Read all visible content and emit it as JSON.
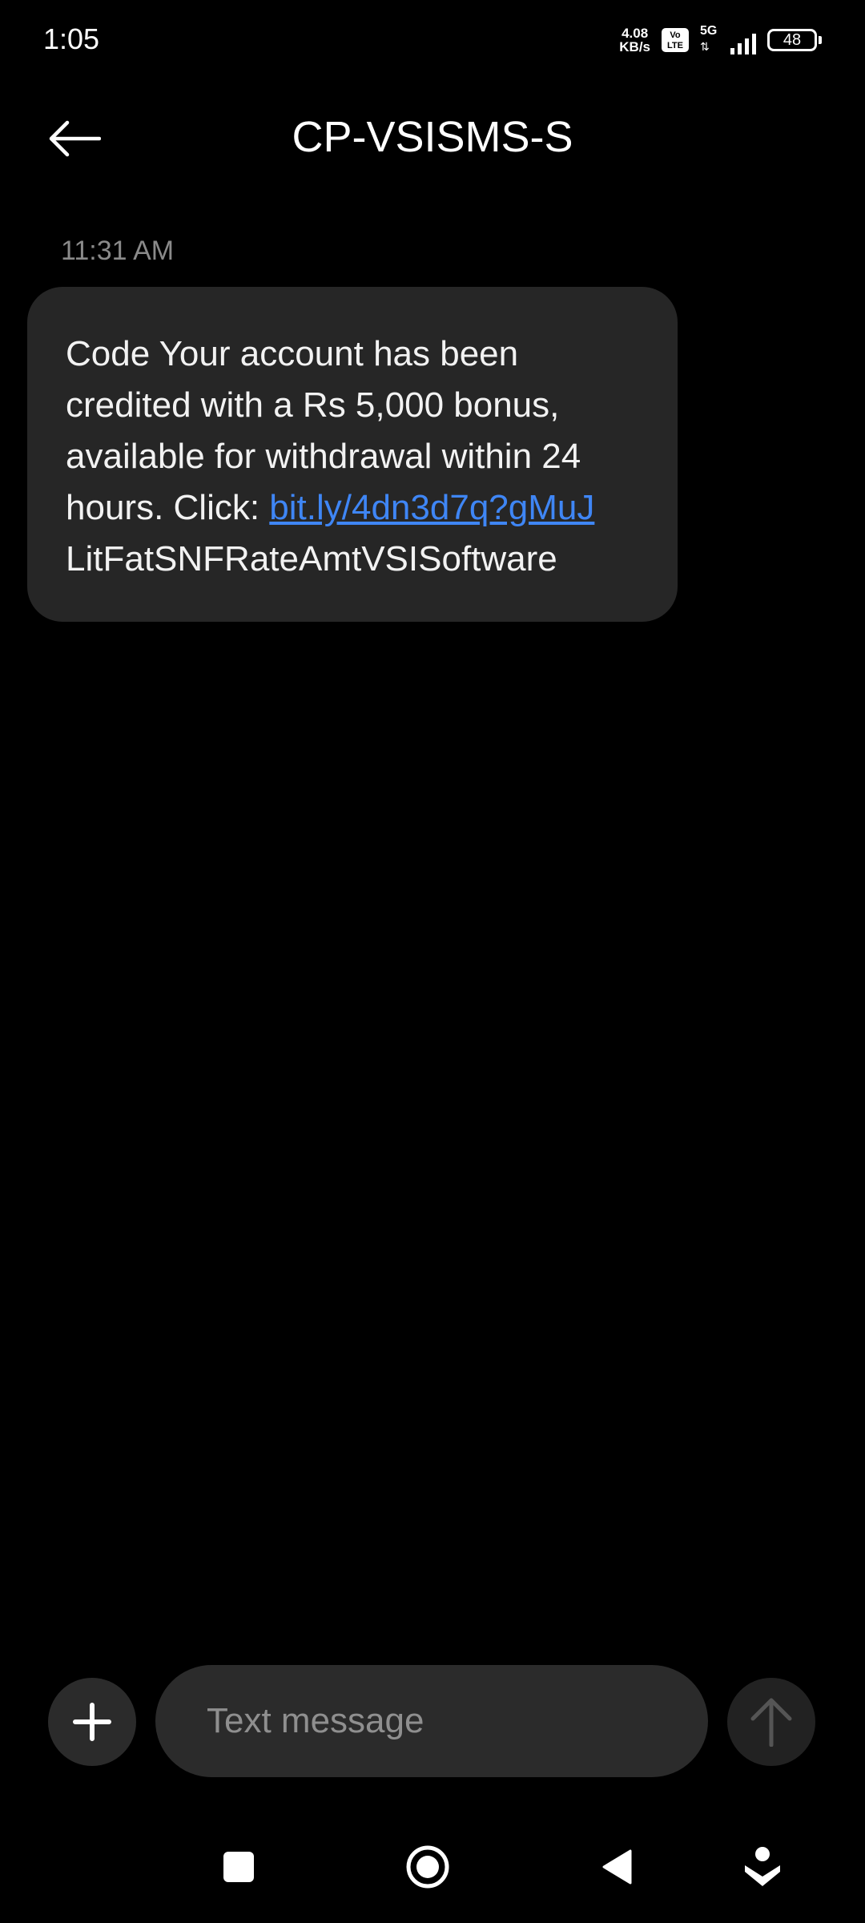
{
  "status_bar": {
    "time": "1:05",
    "net_speed_value": "4.08",
    "net_speed_unit": "KB/s",
    "volte_top": "Vo",
    "volte_bottom": "LTE",
    "network_type": "5G",
    "battery_level": "48"
  },
  "header": {
    "title": "CP-VSISMS-S"
  },
  "conversation": {
    "messages": [
      {
        "timestamp": "11:31 AM",
        "text_before_link": "Code Your account has been credited with a Rs 5,000 bonus, available for withdrawal within 24 hours. Click: ",
        "link_text": "bit.ly/4dn3d7q?gMuJ",
        "text_after_link": "LitFatSNFRateAmtVSISoftware"
      }
    ]
  },
  "composer": {
    "placeholder": "Text message",
    "value": ""
  },
  "colors": {
    "background": "#000000",
    "bubble": "#262626",
    "link": "#3f86f5",
    "composer_field": "#2b2b2b"
  },
  "icons": {
    "back": "arrow-left-icon",
    "attach": "plus-icon",
    "send": "arrow-up-icon",
    "nav_recents": "square-icon",
    "nav_home": "circle-icon",
    "nav_back": "triangle-back-icon",
    "nav_assist": "assistant-icon"
  }
}
